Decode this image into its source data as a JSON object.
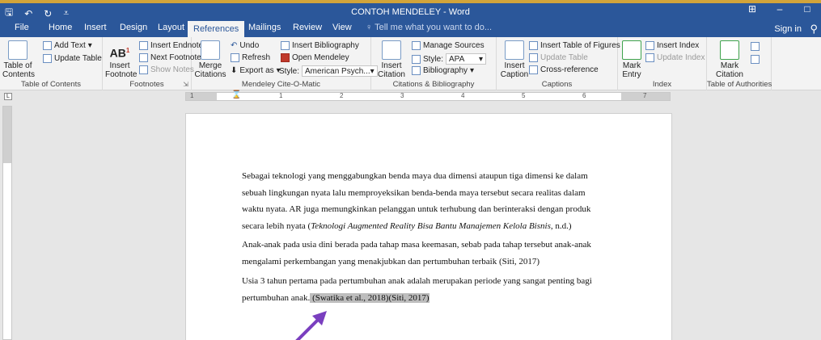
{
  "window": {
    "title": "CONTOH MENDELEY - Word",
    "qat": [
      "save-icon",
      "undo-icon",
      "redo-icon",
      "customize-icon"
    ],
    "controls": [
      "ribbon-display-icon",
      "minimize-icon",
      "maximize-icon"
    ]
  },
  "tabs": [
    {
      "label": "File"
    },
    {
      "label": "Home"
    },
    {
      "label": "Insert"
    },
    {
      "label": "Design"
    },
    {
      "label": "Layout"
    },
    {
      "label": "References",
      "active": true
    },
    {
      "label": "Mailings"
    },
    {
      "label": "Review"
    },
    {
      "label": "View"
    }
  ],
  "tell_me": "Tell me what you want to do...",
  "sign_in": "Sign in",
  "ribbon": {
    "toc": {
      "big": "Table of Contents",
      "add_text": "Add Text",
      "update_table": "Update Table",
      "label": "Table of Contents"
    },
    "footnotes": {
      "big": "Insert Footnote",
      "ab": "AB",
      "sup": "1",
      "insert_endnote": "Insert Endnote",
      "next_footnote": "Next Footnote",
      "show_notes": "Show Notes",
      "label": "Footnotes"
    },
    "mendeley": {
      "merge": "Merge Citations",
      "undo": "Undo",
      "refresh": "Refresh",
      "export": "Export as",
      "insert_bibliography": "Insert Bibliography",
      "open_mendeley": "Open Mendeley",
      "style_label": "Style:",
      "style_value": "American Psych...",
      "label": "Mendeley Cite-O-Matic"
    },
    "citations": {
      "insert_citation": "Insert Citation",
      "manage_sources": "Manage Sources",
      "style_label": "Style:",
      "style_value": "APA",
      "bibliography": "Bibliography",
      "label": "Citations & Bibliography"
    },
    "captions": {
      "insert_caption": "Insert Caption",
      "insert_tof": "Insert Table of Figures",
      "update_table": "Update Table",
      "cross_reference": "Cross-reference",
      "label": "Captions"
    },
    "index": {
      "mark_entry": "Mark Entry",
      "insert_index": "Insert Index",
      "update_index": "Update Index",
      "label": "Index"
    },
    "authorities": {
      "mark_citation": "Mark Citation",
      "label": "Table of Authorities"
    }
  },
  "ruler": {
    "numbers": [
      "1",
      "1",
      "2",
      "3",
      "4",
      "5",
      "6",
      "7"
    ],
    "corner": "L"
  },
  "document": {
    "p1": {
      "line1": "Sebagai teknologi yang menggabungkan benda maya dua dimensi ataupun tiga dimensi ke dalam",
      "line2": "sebuah lingkungan nyata lalu memproyeksikan benda-benda maya tersebut secara realitas dalam",
      "line3": "waktu nyata. AR juga memungkinkan pelanggan untuk terhubung dan berinteraksi dengan produk",
      "line4_pre": "secara lebih nyata (",
      "line4_italic": "Teknologi Augmented Reality Bisa Bantu Manajemen Kelola Bisnis",
      "line4_post": ", n.d.)"
    },
    "p2": {
      "line1": "Anak-anak pada usia dini berada pada tahap masa keemasan, sebab pada tahap tersebut anak-anak",
      "line2": "mengalami perkembangan yang menakjubkan dan pertumbuhan terbaik (Siti, 2017)"
    },
    "p3": {
      "line1": "Usia 3 tahun pertama pada pertumbuhan anak adalah merupakan periode yang sangat penting bagi",
      "line2_pre": "pertumbuhan anak.",
      "line2_highlight": " (Swatika et al., 2018)(Siti, 2017)"
    }
  },
  "colors": {
    "titlebar": "#2b579a",
    "ribbon": "#f3f3f3",
    "highlight": "#bdbdbd",
    "arrow": "#7a3fbf"
  }
}
